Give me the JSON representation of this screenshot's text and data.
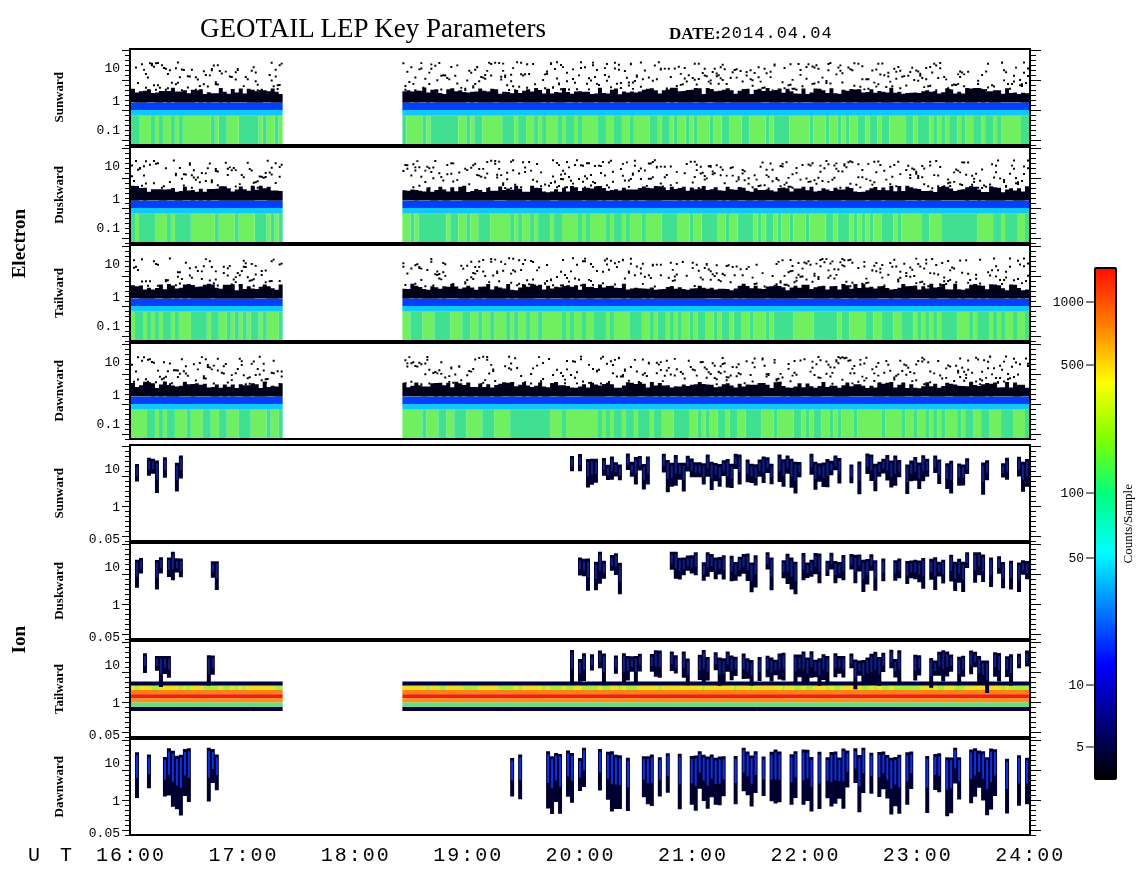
{
  "title": "GEOTAIL LEP Key Parameters",
  "date": {
    "label": "DATE:",
    "value": "2014.04.04"
  },
  "groups": [
    {
      "label": "Electron",
      "panels": [
        {
          "label": "Sunward",
          "kind": "electron",
          "yticks": [
            "10",
            "1",
            "0.1"
          ]
        },
        {
          "label": "Duskward",
          "kind": "electron",
          "yticks": [
            "10",
            "1",
            "0.1"
          ]
        },
        {
          "label": "Tailward",
          "kind": "electron",
          "yticks": [
            "10",
            "1",
            "0.1"
          ]
        },
        {
          "label": "Dawnward",
          "kind": "electron",
          "yticks": [
            "10",
            "1",
            "0.1"
          ]
        }
      ]
    },
    {
      "label": "Ion",
      "panels": [
        {
          "label": "Sunward",
          "kind": "ion",
          "yticks": [
            "10",
            "1",
            "0.05"
          ]
        },
        {
          "label": "Duskward",
          "kind": "ion",
          "yticks": [
            "10",
            "1",
            "0.05"
          ]
        },
        {
          "label": "Tailward",
          "kind": "ion_band",
          "yticks": [
            "10",
            "1",
            "0.05"
          ]
        },
        {
          "label": "Dawnward",
          "kind": "ion",
          "yticks": [
            "10",
            "1",
            "0.05"
          ]
        }
      ]
    }
  ],
  "x_axis": {
    "label": "U T",
    "ticks": [
      "16:00",
      "17:00",
      "18:00",
      "19:00",
      "20:00",
      "21:00",
      "22:00",
      "23:00",
      "24:00"
    ]
  },
  "colorbar": {
    "label": "Counts/Sample",
    "ticks": [
      "1000",
      "500",
      "100",
      "50",
      "10",
      "5"
    ]
  }
}
